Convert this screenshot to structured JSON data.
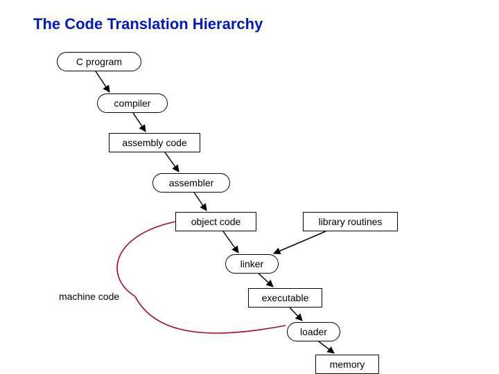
{
  "title": "The Code Translation Hierarchy",
  "nodes": {
    "c_program": "C program",
    "compiler": "compiler",
    "assembly_code": "assembly code",
    "assembler": "assembler",
    "object_code": "object code",
    "library_routines": "library routines",
    "linker": "linker",
    "executable": "executable",
    "loader": "loader",
    "memory": "memory"
  },
  "labels": {
    "machine_code": "machine code"
  }
}
